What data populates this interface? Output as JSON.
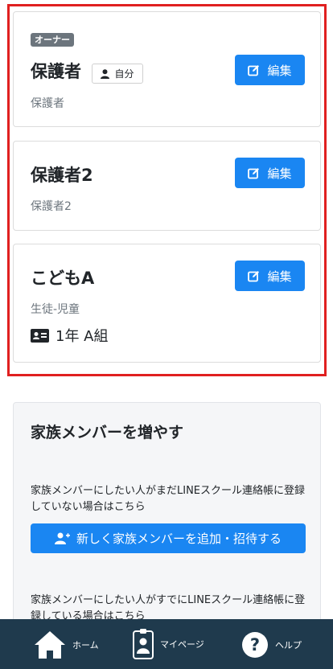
{
  "members": [
    {
      "badge": "オーナー",
      "name": "保護者",
      "self_label": "自分",
      "role": "保護者",
      "edit_label": "編集"
    },
    {
      "name": "保護者2",
      "role": "保護者2",
      "edit_label": "編集"
    },
    {
      "name": "こどもA",
      "role": "生徒-児童",
      "class_label": "1年 A組",
      "edit_label": "編集"
    }
  ],
  "add_family": {
    "title": "家族メンバーを増やす",
    "desc_new": "家族メンバーにしたい人がまだLINEスクール連絡帳に登録していない場合はこちら",
    "invite_button": "新しく家族メンバーを追加・招待する",
    "desc_existing": "家族メンバーにしたい人がすでにLINEスクール連絡帳に登録している場合はこちら"
  },
  "bottom_nav": {
    "home": "ホーム",
    "mypage": "マイページ",
    "help": "ヘルプ"
  },
  "colors": {
    "primary": "#1a86f2",
    "highlight": "#e02020",
    "nav_bg": "#1f3a4d",
    "badge_bg": "#6c757d"
  }
}
